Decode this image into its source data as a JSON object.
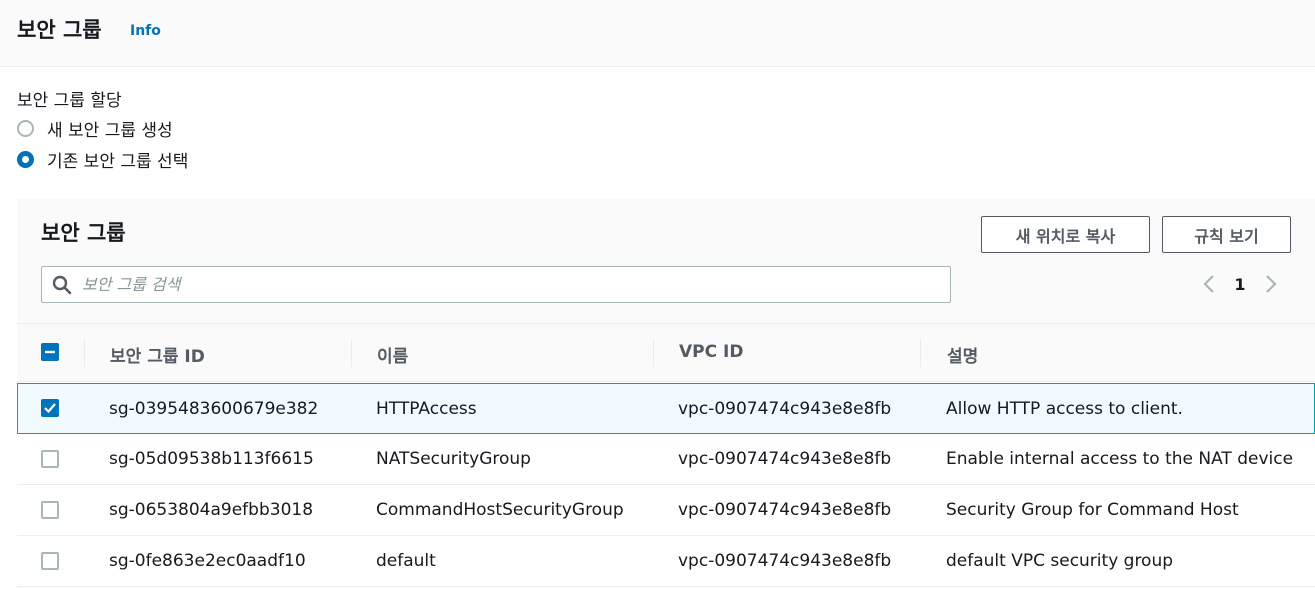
{
  "header": {
    "title": "보안 그룹",
    "info": "Info"
  },
  "assignment": {
    "label": "보안 그룹 할당",
    "options": [
      {
        "label": "새 보안 그룹 생성",
        "selected": false
      },
      {
        "label": "기존 보안 그룹 선택",
        "selected": true
      }
    ]
  },
  "panel": {
    "title": "보안 그룹",
    "copy_button": "새 위치로 복사",
    "rules_button": "규칙 보기",
    "search_placeholder": "보안 그룹 검색",
    "page": "1"
  },
  "table": {
    "columns": [
      "보안 그룹 ID",
      "이름",
      "VPC ID",
      "설명"
    ],
    "rows": [
      {
        "id": "sg-0395483600679e382",
        "name": "HTTPAccess",
        "vpc": "vpc-0907474c943e8e8fb",
        "desc": "Allow HTTP access to client.",
        "checked": true
      },
      {
        "id": "sg-05d09538b113f6615",
        "name": "NATSecurityGroup",
        "vpc": "vpc-0907474c943e8e8fb",
        "desc": "Enable internal access to the NAT device",
        "checked": false
      },
      {
        "id": "sg-0653804a9efbb3018",
        "name": "CommandHostSecurityGroup",
        "vpc": "vpc-0907474c943e8e8fb",
        "desc": "Security Group for Command Host",
        "checked": false
      },
      {
        "id": "sg-0fe863e2ec0aadf10",
        "name": "default",
        "vpc": "vpc-0907474c943e8e8fb",
        "desc": "default VPC security group",
        "checked": false
      }
    ]
  },
  "colors": {
    "accent": "#0073bb",
    "selected_row_bg": "#f1faff",
    "selected_row_border": "#00a1c9"
  }
}
